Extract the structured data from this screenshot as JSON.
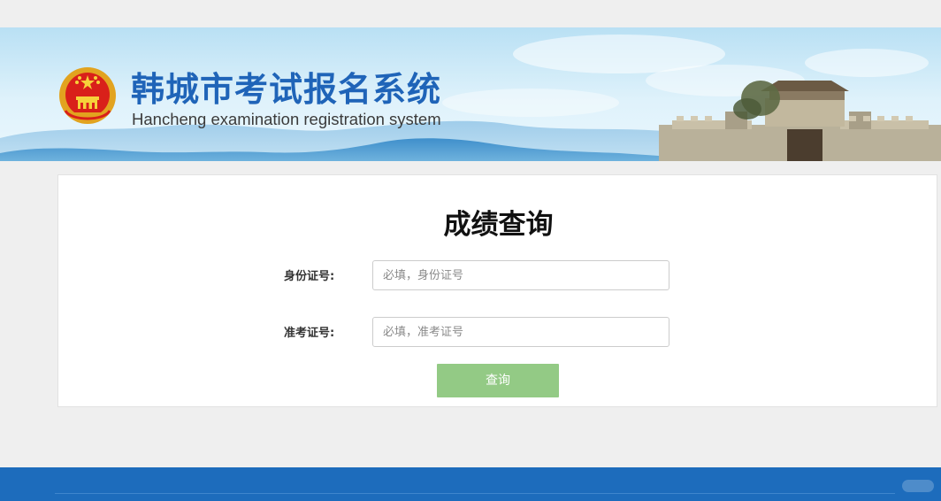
{
  "header": {
    "title_cn": "韩城市考试报名系统",
    "title_en": "Hancheng examination registration system",
    "emblem_icon": "national-emblem-icon",
    "banner_colors": {
      "sky": "#bfe3f5",
      "mountains": "#5fa6d6",
      "title": "#1f64b8"
    }
  },
  "form": {
    "title": "成绩查询",
    "id_number": {
      "label": "身份证号:",
      "placeholder": "必填，身份证号",
      "value": ""
    },
    "exam_number": {
      "label": "准考证号:",
      "placeholder": "必填，准考证号",
      "value": ""
    },
    "submit_label": "查询",
    "button_color": "#93ca85"
  },
  "footer": {
    "color": "#1d6cbc"
  }
}
